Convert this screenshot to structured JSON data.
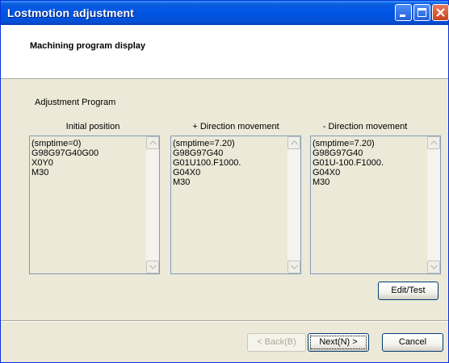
{
  "window": {
    "title": "Lostmotion adjustment"
  },
  "header": {
    "title": "Machining program display"
  },
  "group": {
    "label": "Adjustment Program"
  },
  "columns": [
    {
      "label": "Initial position",
      "text": "(smptime=0)\nG98G97G40G00\nX0Y0\nM30"
    },
    {
      "label": "+ Direction movement",
      "text": "(smptime=7.20)\nG98G97G40\nG01U100.F1000.\nG04X0\nM30"
    },
    {
      "label": "- Direction movement",
      "text": "(smptime=7.20)\nG98G97G40\nG01U-100.F1000.\nG04X0\nM30"
    }
  ],
  "buttons": {
    "edit_test": "Edit/Test",
    "back": "< Back(B)",
    "next": "Next(N) >",
    "cancel": "Cancel"
  },
  "icons": {
    "minimize": "minimize-icon",
    "maximize": "maximize-icon",
    "close": "close-icon",
    "scroll_up": "scroll-up-arrow-icon",
    "scroll_down": "scroll-down-arrow-icon"
  },
  "colors": {
    "titlebar": "#0054e3",
    "dialog": "#ece9d8",
    "border": "#0831d9"
  }
}
